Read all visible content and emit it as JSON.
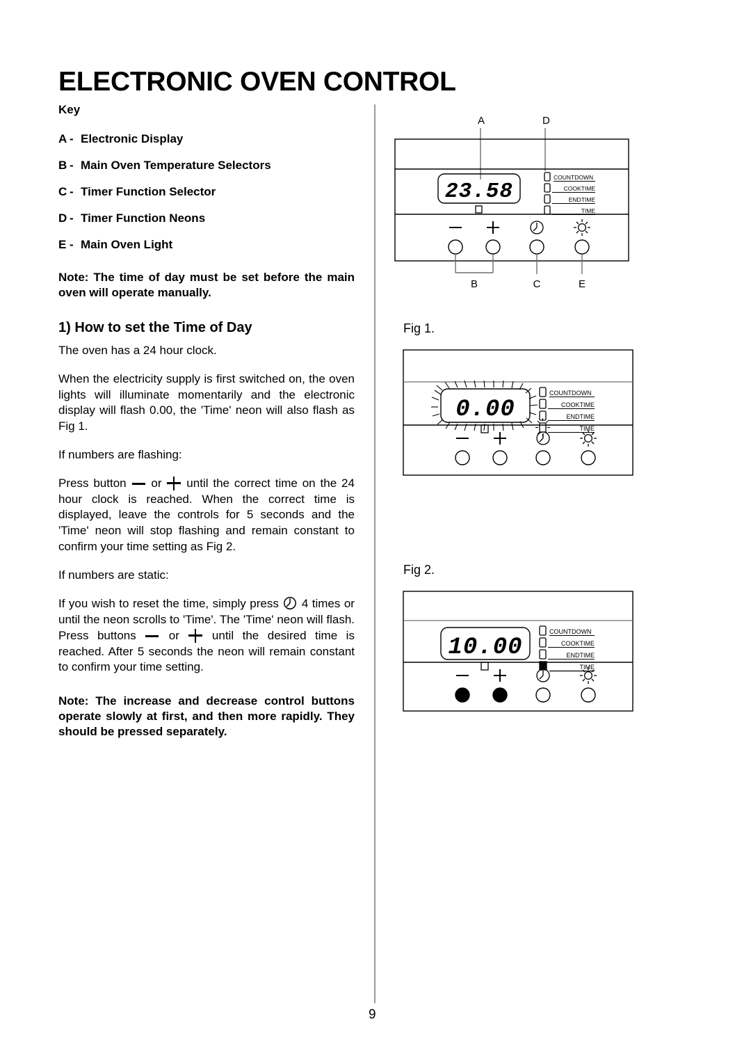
{
  "document": {
    "title": "ELECTRONIC OVEN CONTROL",
    "page_number": "9"
  },
  "key": {
    "heading": "Key",
    "items": [
      {
        "letter": "A",
        "dash": "-",
        "label": "Electronic Display"
      },
      {
        "letter": "B",
        "dash": "-",
        "label": "Main Oven Temperature Selectors"
      },
      {
        "letter": "C",
        "dash": "-",
        "label": "Timer Function Selector"
      },
      {
        "letter": "D",
        "dash": "-",
        "label": "Timer Function Neons"
      },
      {
        "letter": "E",
        "dash": "-",
        "label": "Main Oven Light"
      }
    ]
  },
  "notes": {
    "note_top": "Note: The time of day must be set before the main oven will operate manually.",
    "note_bottom": "Note:   The increase and decrease control buttons operate slowly at first, and then more rapidly. They should be pressed separately."
  },
  "section": {
    "heading": "1) How to set the Time of Day",
    "para1_line1": "The oven has a 24 hour clock.",
    "para1_rest": "When the electricity supply is first switched on, the oven lights will illuminate momentarily and the electronic display will flash 0.00, the 'Time' neon will also flash as Fig 1.",
    "flashing_heading": "If numbers are flashing:",
    "flashing_text_a": "Press button",
    "flashing_text_or": "or",
    "flashing_text_b": "until the correct time on the 24 hour clock is reached. When the correct time is displayed, leave the controls for 5 seconds and the 'Time' neon will stop flashing and remain constant to confirm your time setting as Fig 2.",
    "static_heading": "If numbers are static:",
    "static_text_a": "If you wish to reset the time, simply press",
    "static_count": "4",
    "static_text_b": "times or until the neon scrolls to 'Time'.  The 'Time' neon will flash.  Press buttons",
    "static_text_or": "or",
    "static_text_c": "until the desired time is reached.  After 5 seconds the neon will remain constant to confirm your time setting."
  },
  "figures": {
    "panel_labels": {
      "a": "A",
      "b": "B",
      "c": "C",
      "d": "D",
      "e": "E"
    },
    "neons": [
      "COUNTDOWN",
      "COOKTIME",
      "ENDTIME",
      "TIME"
    ],
    "button_icons": [
      "minus-icon",
      "plus-icon",
      "clock-icon",
      "light-icon"
    ],
    "diagram_key": {
      "display_value": "23.58",
      "caption": ""
    },
    "fig1": {
      "caption": "Fig 1.",
      "display_value": "0.00",
      "display_state": "flashing",
      "neon_active": "TIME",
      "neon_state": "flashing"
    },
    "fig2": {
      "caption": "Fig 2.",
      "display_value": "10.00",
      "display_state": "static",
      "neon_active": "TIME",
      "neon_state": "constant",
      "pressed_buttons": [
        "minus-icon",
        "plus-icon"
      ]
    }
  },
  "colors": {
    "ink": "#000000",
    "divider": "#9a9a9a"
  }
}
